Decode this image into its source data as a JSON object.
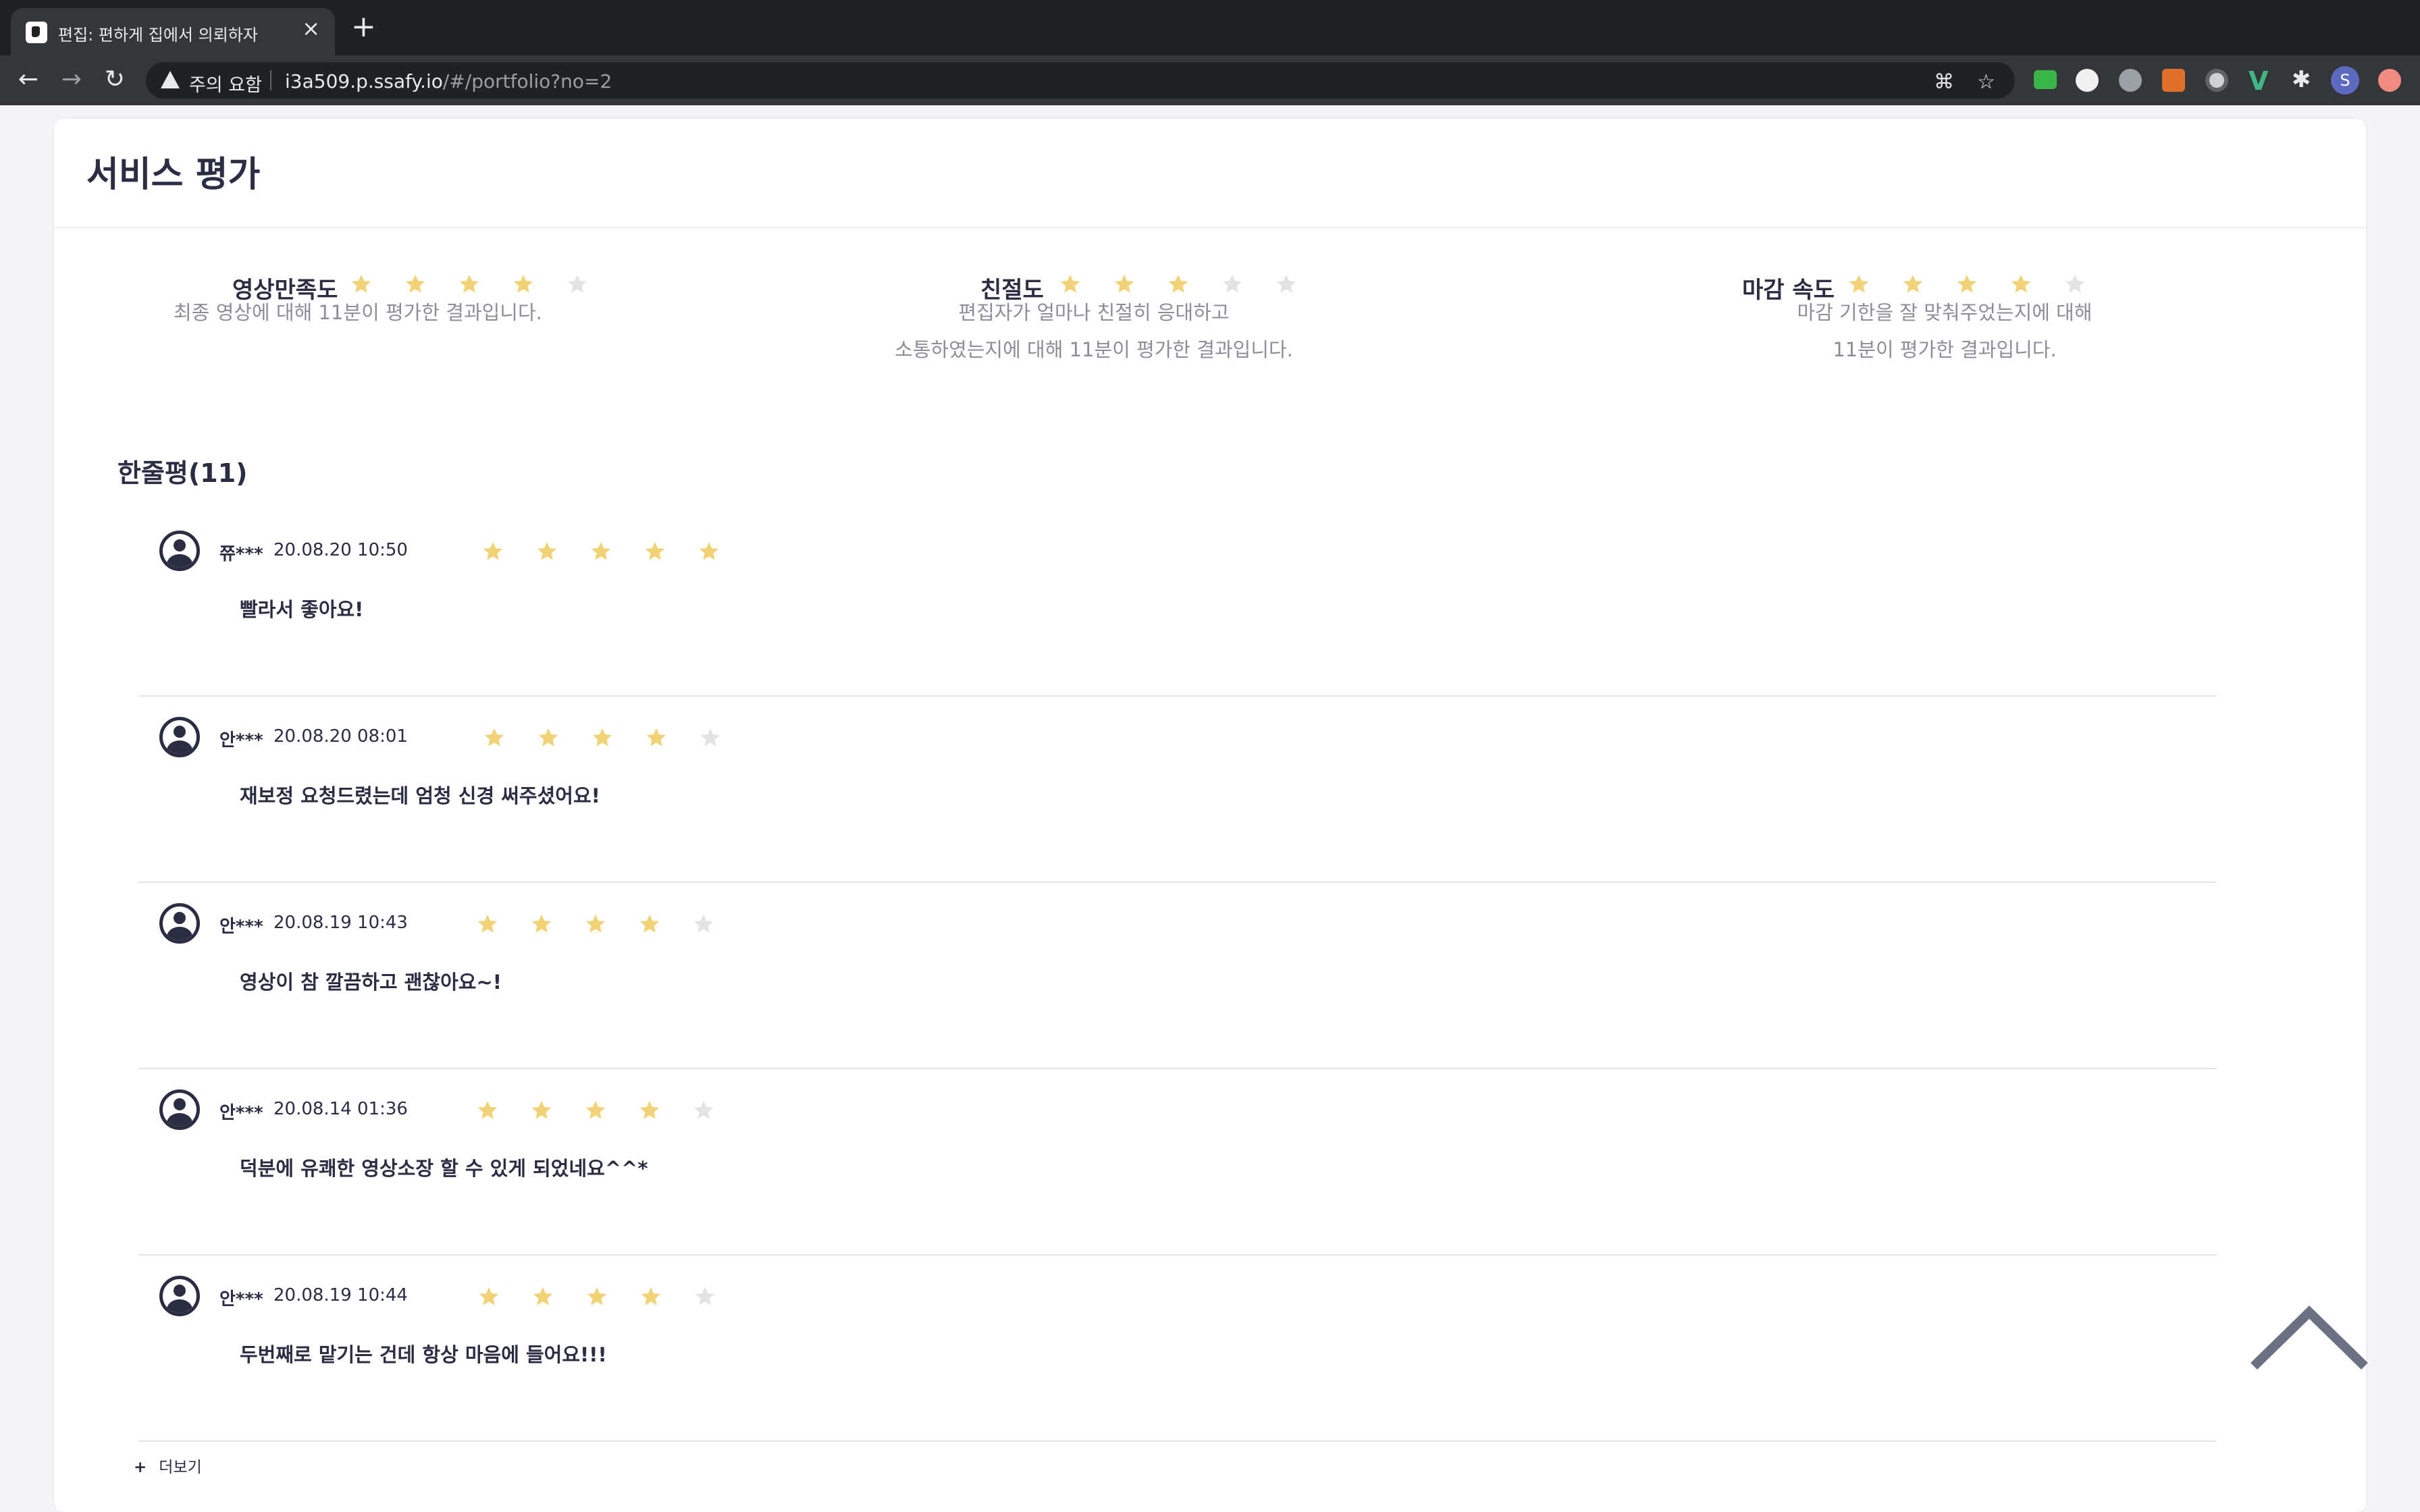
{
  "browser": {
    "tab_title": "편집: 편하게 집에서 의뢰하자",
    "tab_close": "×",
    "new_tab": "+",
    "security_warning": "주의 요함",
    "url_host": "i3a509.p.ssafy.io",
    "url_path": "/#/portfolio?no=2",
    "profile_initial": "S",
    "extension_icons": [
      "ac-extension-icon",
      "circle-extension-icon",
      "privacy-extension-icon",
      "ex-extension-icon",
      "record-extension-icon",
      "vue-devtools-icon",
      "puzzle-extensions-icon"
    ]
  },
  "page": {
    "section_title": "서비스 평가",
    "summary": [
      {
        "label": "영상만족도",
        "rating": 4,
        "max": 5,
        "desc_lines": [
          "최종 영상에 대해 11분이 평가한 결과입니다."
        ]
      },
      {
        "label": "친절도",
        "rating": 3,
        "max": 5,
        "desc_lines": [
          "편집자가 얼마나 친절히 응대하고",
          "소통하였는지에 대해 11분이 평가한 결과입니다."
        ]
      },
      {
        "label": "마감 속도",
        "rating": 4,
        "max": 5,
        "desc_lines": [
          "마감 기한을 잘 맞춰주었는지에 대해",
          "11분이 평가한 결과입니다."
        ]
      }
    ],
    "reviews_title": "한줄평(11)",
    "reviews": [
      {
        "name": "쮸***",
        "date": "20.08.20 10:50",
        "rating": 5,
        "text": "빨라서 좋아요!"
      },
      {
        "name": "안***",
        "date": "20.08.20 08:01",
        "rating": 4,
        "text": "재보정 요청드렸는데 엄청 신경 써주셨어요!"
      },
      {
        "name": "안***",
        "date": "20.08.19 10:43",
        "rating": 4,
        "text": "영상이 참 깔끔하고 괜찮아요~!"
      },
      {
        "name": "안***",
        "date": "20.08.14 01:36",
        "rating": 4,
        "text": "덕분에 유쾌한 영상소장 할 수 있게 되었네요^^*"
      },
      {
        "name": "안***",
        "date": "20.08.19 10:44",
        "rating": 4,
        "text": "두번째로 맡기는 건데 항상 마음에 들어요!!!"
      }
    ],
    "more_icon": "+",
    "more_label": "더보기"
  },
  "colors": {
    "star_filled": "#f2d276",
    "star_empty": "#e3e3e6",
    "text_dark": "#2b2d42",
    "text_muted": "#8d8d99",
    "browser_dark": "#202124",
    "browser_bar": "#35363a"
  }
}
